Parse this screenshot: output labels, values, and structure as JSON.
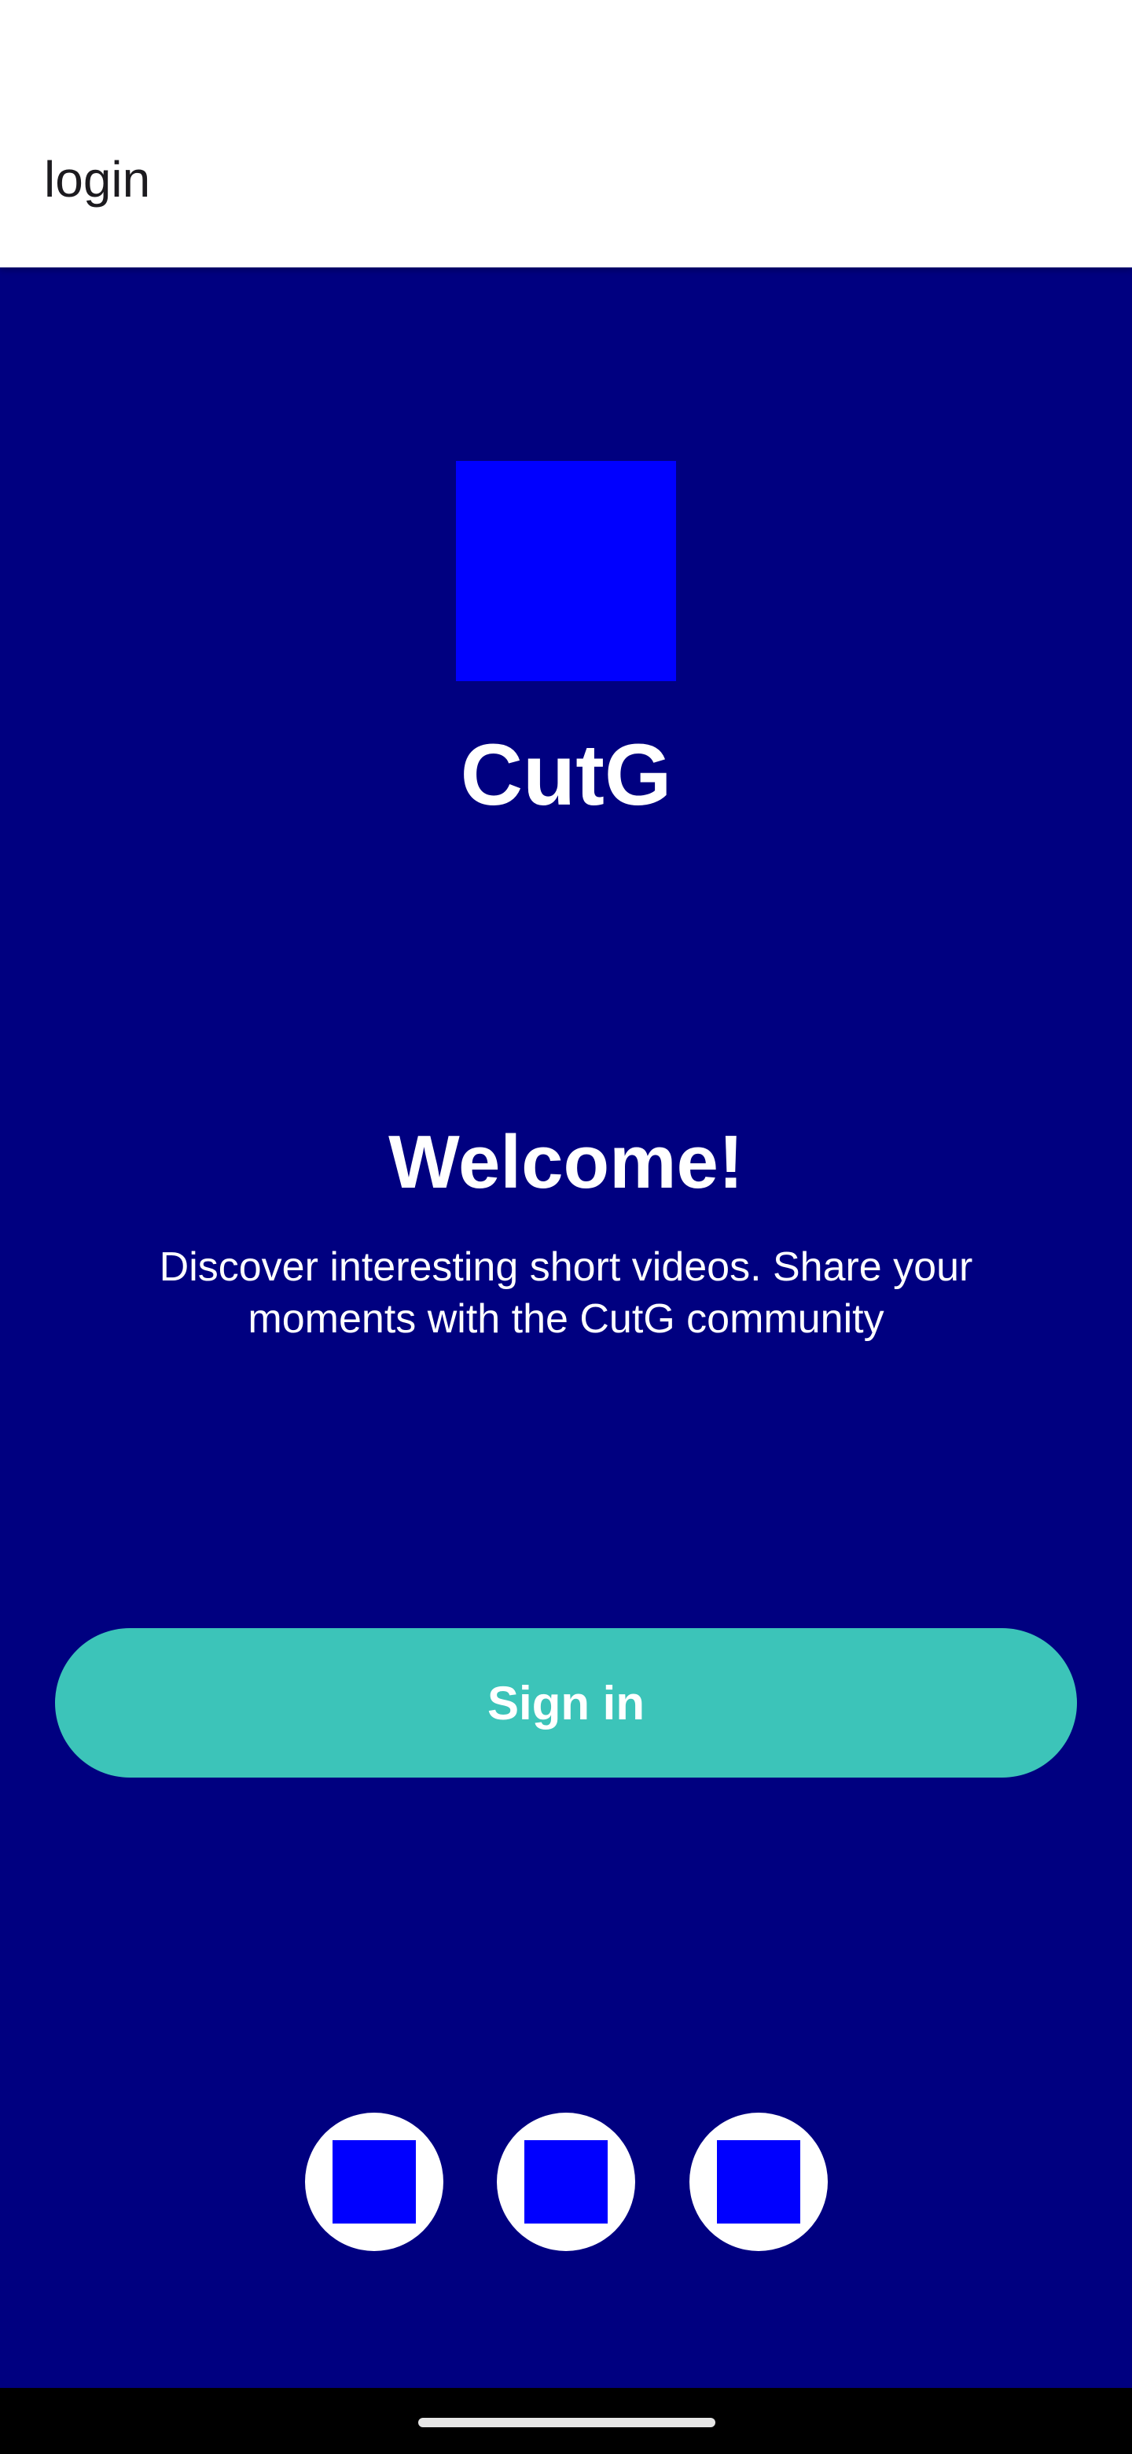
{
  "app_bar": {
    "title": "login"
  },
  "branding": {
    "logo_icon": "app-logo-placeholder",
    "app_name": "CutG"
  },
  "welcome": {
    "title": "Welcome!",
    "description": "Discover interesting short videos. Share your moments with the CutG community"
  },
  "actions": {
    "sign_in_label": "Sign in"
  },
  "social_logins": [
    {
      "icon": "social-login-icon-1"
    },
    {
      "icon": "social-login-icon-2"
    },
    {
      "icon": "social-login-icon-3"
    }
  ],
  "colors": {
    "background": "#000080",
    "app_bar": "#ffffff",
    "accent": "#3cc4b9",
    "icon_placeholder": "#0000ff",
    "text_on_dark": "#ffffff"
  }
}
